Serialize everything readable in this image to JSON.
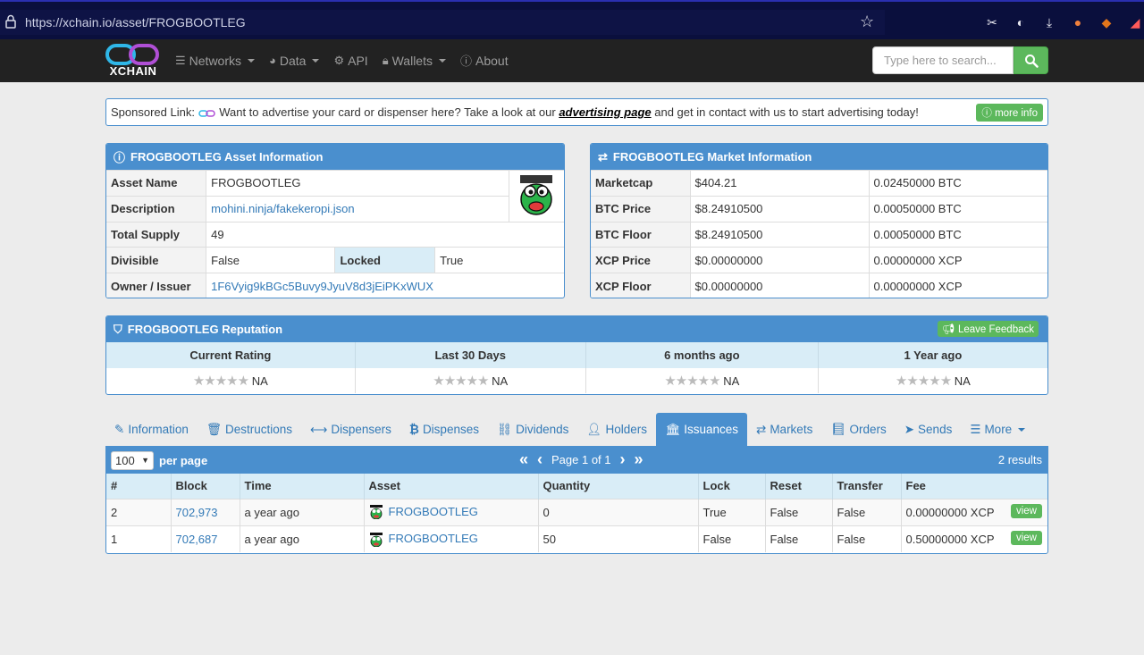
{
  "browser": {
    "url": "https://xchain.io/asset/FROGBOOTLEG"
  },
  "navbar": {
    "logo_text": "XCHAIN",
    "items": [
      {
        "label": "Networks",
        "icon": "database-icon",
        "dropdown": true
      },
      {
        "label": "Data",
        "icon": "dashboard-icon",
        "dropdown": true
      },
      {
        "label": "API",
        "icon": "gears-icon",
        "dropdown": false
      },
      {
        "label": "Wallets",
        "icon": "lock-icon",
        "dropdown": true
      },
      {
        "label": "About",
        "icon": "info-icon",
        "dropdown": false
      }
    ],
    "search_placeholder": "Type here to search..."
  },
  "sponsored": {
    "prefix": "Sponsored Link:",
    "text_before": "Want to advertise your card or dispenser here? Take a look at our",
    "link": "advertising page",
    "text_after": "and get in contact with us to start advertising today!",
    "button": "more info"
  },
  "asset_info": {
    "title": "FROGBOOTLEG Asset Information",
    "rows": {
      "asset_name_label": "Asset Name",
      "asset_name": "FROGBOOTLEG",
      "description_label": "Description",
      "description": "mohini.ninja/fakekeropi.json",
      "total_supply_label": "Total Supply",
      "total_supply": "49",
      "divisible_label": "Divisible",
      "divisible": "False",
      "locked_label": "Locked",
      "locked": "True",
      "owner_label": "Owner / Issuer",
      "owner": "1F6Vyig9kBGc5Buvy9JyuV8d3jEiPKxWUX"
    }
  },
  "market_info": {
    "title": "FROGBOOTLEG Market Information",
    "rows": [
      {
        "label": "Marketcap",
        "usd": "$404.21",
        "native": "0.02450000 BTC"
      },
      {
        "label": "BTC Price",
        "usd": "$8.24910500",
        "native": "0.00050000 BTC"
      },
      {
        "label": "BTC Floor",
        "usd": "$8.24910500",
        "native": "0.00050000 BTC"
      },
      {
        "label": "XCP Price",
        "usd": "$0.00000000",
        "native": "0.00000000 XCP"
      },
      {
        "label": "XCP Floor",
        "usd": "$0.00000000",
        "native": "0.00000000 XCP"
      }
    ]
  },
  "reputation": {
    "title": "FROGBOOTLEG Reputation",
    "feedback_button": "Leave Feedback",
    "columns": [
      "Current Rating",
      "Last 30 Days",
      "6 months ago",
      "1 Year ago"
    ],
    "values": [
      "NA",
      "NA",
      "NA",
      "NA"
    ]
  },
  "tabs": [
    {
      "label": "Information",
      "icon": "wrench-icon"
    },
    {
      "label": "Destructions",
      "icon": "trash-icon"
    },
    {
      "label": "Dispensers",
      "icon": "arrows-h-icon"
    },
    {
      "label": "Dispenses",
      "icon": "bitcoin-icon"
    },
    {
      "label": "Dividends",
      "icon": "sitemap-icon"
    },
    {
      "label": "Holders",
      "icon": "user-icon"
    },
    {
      "label": "Issuances",
      "icon": "bank-icon",
      "active": true
    },
    {
      "label": "Markets",
      "icon": "exchange-icon"
    },
    {
      "label": "Orders",
      "icon": "book-icon"
    },
    {
      "label": "Sends",
      "icon": "paper-plane-icon"
    },
    {
      "label": "More",
      "icon": "list-icon",
      "dropdown": true
    }
  ],
  "issuances": {
    "per_page_value": "100",
    "per_page_label": "per page",
    "page_text": "Page 1 of 1",
    "results_text": "2 results",
    "headers": [
      "#",
      "Block",
      "Time",
      "Asset",
      "Quantity",
      "Lock",
      "Reset",
      "Transfer",
      "Fee"
    ],
    "rows": [
      {
        "num": "2",
        "block": "702,973",
        "time": "a year ago",
        "asset": "FROGBOOTLEG",
        "quantity": "0",
        "lock": "True",
        "reset": "False",
        "transfer": "False",
        "fee": "0.00000000 XCP",
        "action": "view"
      },
      {
        "num": "1",
        "block": "702,687",
        "time": "a year ago",
        "asset": "FROGBOOTLEG",
        "quantity": "50",
        "lock": "False",
        "reset": "False",
        "transfer": "False",
        "fee": "0.50000000 XCP",
        "action": "view"
      }
    ]
  },
  "colors": {
    "primary": "#4a8fce",
    "success": "#5cb85c",
    "navbar": "#222222",
    "link": "#337ab7"
  }
}
